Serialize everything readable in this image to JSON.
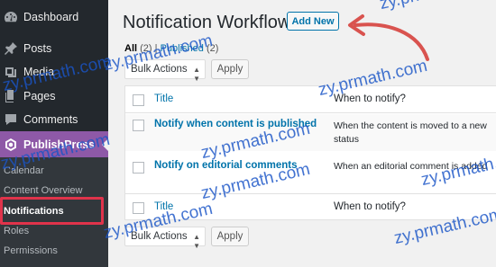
{
  "sidebar": {
    "items": [
      {
        "label": "Dashboard",
        "icon": "dashboard-icon"
      },
      {
        "label": "Posts",
        "icon": "pin-icon"
      },
      {
        "label": "Media",
        "icon": "media-icon"
      },
      {
        "label": "Pages",
        "icon": "pages-icon"
      },
      {
        "label": "Comments",
        "icon": "comments-icon"
      },
      {
        "label": "PublishPress",
        "icon": "publishpress-icon"
      }
    ],
    "submenu": [
      "Calendar",
      "Content Overview",
      "Notifications",
      "Roles",
      "Permissions",
      "..."
    ],
    "active_submenu": "Notifications",
    "accent_color": "#8e59a7",
    "highlight_color": "#e0334b"
  },
  "header": {
    "title": "Notification Workflows",
    "add_new_label": "Add New"
  },
  "filters": {
    "all_label": "All",
    "all_count": "(2)",
    "separator": "|",
    "published_label": "Published",
    "published_count": "(2)"
  },
  "bulk_actions": {
    "selected": "Bulk Actions",
    "apply_label": "Apply"
  },
  "table": {
    "columns": [
      "Title",
      "When to notify?"
    ],
    "rows": [
      {
        "title": "Notify when content is published",
        "when": "When the content is moved to a new status"
      },
      {
        "title": "Notify on editorial comments",
        "when": "When an editorial comment is added"
      }
    ]
  },
  "watermark": "zy.prmath.com"
}
